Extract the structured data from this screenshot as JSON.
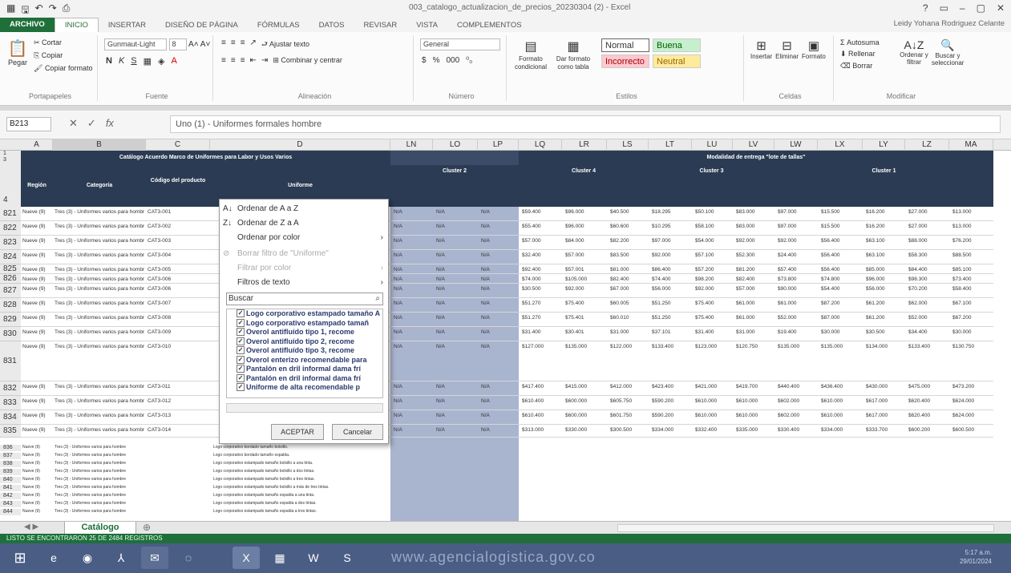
{
  "titlebar": {
    "document_title": "003_catalogo_actualizacion_de_precios_20230304 (2) - Excel",
    "window_controls": [
      "?",
      "▭",
      "–",
      "▢",
      "✕"
    ]
  },
  "tabs": [
    "ARCHIVO",
    "INICIO",
    "INSERTAR",
    "DISEÑO DE PÁGINA",
    "FÓRMULAS",
    "DATOS",
    "REVISAR",
    "VISTA",
    "COMPLEMENTOS"
  ],
  "user": "Leidy Yohana Rodriguez Celante",
  "ribbon": {
    "clipboard": {
      "paste": "Pegar",
      "cut": "Cortar",
      "copy": "Copiar",
      "format_painter": "Copiar formato",
      "label": "Portapapeles"
    },
    "font": {
      "name": "Gunmaut-Light",
      "size": "8",
      "bold": "N",
      "italic": "K",
      "underline": "S",
      "label": "Fuente"
    },
    "alignment": {
      "wrap": "Ajustar texto",
      "merge": "Combinar y centrar",
      "label": "Alineación"
    },
    "number": {
      "format": "General",
      "currency": "$",
      "percent": "%",
      "thousands": "000",
      "label": "Número"
    },
    "styles": {
      "conditional": "Formato condicional",
      "as_table": "Dar formato como tabla",
      "normal": "Normal",
      "good": "Buena",
      "bad": "Incorrecto",
      "neutral": "Neutral",
      "label": "Estilos"
    },
    "cells": {
      "insert": "Insertar",
      "delete": "Eliminar",
      "format": "Formato",
      "label": "Celdas"
    },
    "editing": {
      "autosum": "Autosuma",
      "fill": "Rellenar",
      "clear": "Borrar",
      "sort": "Ordenar y filtrar",
      "find": "Buscar y seleccionar",
      "label": "Modificar"
    }
  },
  "formula_bar": {
    "name_box": "B213",
    "formula": "Uno (1) - Uniformes formales hombre"
  },
  "columns": [
    "A",
    "B",
    "C",
    "D",
    "LN",
    "LO",
    "LP",
    "LQ",
    "LR",
    "LS",
    "LT",
    "LU",
    "LV",
    "LW",
    "LX",
    "LY",
    "LZ",
    "MA"
  ],
  "table_title": "Catálogo Acuerdo Marco de Uniformes para Labor y Usos Varios",
  "modality_title": "Modalidad de entrega \"lote de tallas\"",
  "headers": {
    "region": "Región",
    "category": "Categoría",
    "code": "Código del producto",
    "uniform": "Uniforme",
    "cluster_left": "Cluster 2",
    "cluster_mid": "Cluster 4",
    "cluster_right": "Cluster 3",
    "cluster_far": "Cluster 1"
  },
  "rows": [
    {
      "num": "821",
      "region": "Nueve (9)",
      "category": "Tres (3) - Uniformes varios para hombre",
      "code": "CAT3-001"
    },
    {
      "num": "822",
      "region": "Nueve (9)",
      "category": "Tres (3) - Uniformes varios para hombre",
      "code": "CAT3-002"
    },
    {
      "num": "823",
      "region": "Nueve (9)",
      "category": "Tres (3) - Uniformes varios para hombre",
      "code": "CAT3-003"
    },
    {
      "num": "824",
      "region": "Nueve (9)",
      "category": "Tres (3) - Uniformes varios para hombre",
      "code": "CAT3-004"
    },
    {
      "num": "825",
      "region": "Nueve (9)",
      "category": "Tres (3) - Uniformes varios para hombre",
      "code": "CAT3-005"
    },
    {
      "num": "826",
      "region": "Nueve (9)",
      "category": "Tres (3) - Uniformes varios para hombre",
      "code": "CAT3-006"
    },
    {
      "num": "827",
      "region": "Nueve (9)",
      "category": "Tres (3) - Uniformes varios para hombre",
      "code": "CAT3-006"
    },
    {
      "num": "828",
      "region": "Nueve (9)",
      "category": "Tres (3) - Uniformes varios para hombre",
      "code": "CAT3-007"
    },
    {
      "num": "829",
      "region": "Nueve (9)",
      "category": "Tres (3) - Uniformes varios para hombre",
      "code": "CAT3-008"
    },
    {
      "num": "830",
      "region": "Nueve (9)",
      "category": "Tres (3) - Uniformes varios para hombre",
      "code": "CAT3-009"
    },
    {
      "num": "831",
      "region": "Nueve (9)",
      "category": "Tres (3) - Uniformes varios para hombre",
      "code": "CAT3-010"
    },
    {
      "num": "832",
      "region": "Nueve (9)",
      "category": "Tres (3) - Uniformes varios para hombre",
      "code": "CAT3-011"
    },
    {
      "num": "833",
      "region": "Nueve (9)",
      "category": "Tres (3) - Uniformes varios para hombre",
      "code": "CAT3-012"
    },
    {
      "num": "834",
      "region": "Nueve (9)",
      "category": "Tres (3) - Uniformes varios para hombre",
      "code": "CAT3-013"
    },
    {
      "num": "835",
      "region": "Nueve (9)",
      "category": "Tres (3) - Uniformes varios para hombre",
      "code": "CAT3-014"
    }
  ],
  "row_values": [
    [
      "N/A",
      "N/A",
      "N/A",
      "$59.400",
      "$96.000",
      "$40.500",
      "$18.295",
      "$50.100",
      "$83.000",
      "$97.000",
      "$15.500",
      "$16.200",
      "$27.000",
      "$13.000"
    ],
    [
      "N/A",
      "N/A",
      "N/A",
      "$55.400",
      "$96.000",
      "$60.600",
      "$10.295",
      "$58.100",
      "$83.000",
      "$97.000",
      "$15.500",
      "$16.200",
      "$27.000",
      "$13.000"
    ],
    [
      "N/A",
      "N/A",
      "N/A",
      "$57.000",
      "$84.000",
      "$82.200",
      "$97.000",
      "$54.000",
      "$92.000",
      "$92.000",
      "$56.400",
      "$63.100",
      "$88.000",
      "$76.200"
    ],
    [
      "N/A",
      "N/A",
      "N/A",
      "$32.400",
      "$57.000",
      "$83.500",
      "$92.000",
      "$57.100",
      "$52.300",
      "$24.400",
      "$56.400",
      "$63.100",
      "$58.300",
      "$88.500"
    ],
    [
      "N/A",
      "N/A",
      "N/A",
      "$92.400",
      "$57.001",
      "$81.000",
      "$86.400",
      "$57.200",
      "$81.200",
      "$57.400",
      "$56.400",
      "$85.000",
      "$84.400",
      "$85.100"
    ],
    [
      "N/A",
      "N/A",
      "N/A",
      "$74.000",
      "$105.000",
      "$82.400",
      "$74.400",
      "$98.200",
      "$82.400",
      "$73.800",
      "$74.800",
      "$96.000",
      "$98.300",
      "$73.400"
    ],
    [
      "N/A",
      "N/A",
      "N/A",
      "$30.500",
      "$92.000",
      "$67.000",
      "$56.000",
      "$92.000",
      "$57.000",
      "$90.000",
      "$54.400",
      "$56.000",
      "$70.200",
      "$58.400"
    ],
    [
      "N/A",
      "N/A",
      "N/A",
      "$51.270",
      "$75.400",
      "$60.005",
      "$51.250",
      "$75.400",
      "$61.000",
      "$61.000",
      "$87.200",
      "$61.200",
      "$62.000",
      "$67.100"
    ],
    [
      "N/A",
      "N/A",
      "N/A",
      "$51.270",
      "$75.401",
      "$60.010",
      "$51.250",
      "$75.400",
      "$61.000",
      "$52.000",
      "$87.000",
      "$61.200",
      "$52.000",
      "$67.200"
    ],
    [
      "N/A",
      "N/A",
      "N/A",
      "$31.400",
      "$30.401",
      "$31.000",
      "$37.101",
      "$31.400",
      "$31.000",
      "$19.400",
      "$30.000",
      "$30.500",
      "$34.400",
      "$30.000"
    ],
    [
      "N/A",
      "N/A",
      "N/A",
      "$127.000",
      "$135.000",
      "$122.000",
      "$133.400",
      "$123.000",
      "$120.750",
      "$135.000",
      "$135.000",
      "$134.000",
      "$133.400",
      "$130.750"
    ],
    [
      "N/A",
      "N/A",
      "N/A",
      "$417.400",
      "$415.000",
      "$412.000",
      "$423.400",
      "$421.000",
      "$419.700",
      "$440.400",
      "$436.400",
      "$430.000",
      "$475.000",
      "$473.200"
    ],
    [
      "N/A",
      "N/A",
      "N/A",
      "$610.400",
      "$600.000",
      "$605.750",
      "$590.200",
      "$610.000",
      "$610.000",
      "$602.000",
      "$610.000",
      "$617.000",
      "$620.400",
      "$624.000"
    ],
    [
      "N/A",
      "N/A",
      "N/A",
      "$610.400",
      "$600.000",
      "$601.750",
      "$590.200",
      "$610.000",
      "$610.000",
      "$602.000",
      "$610.000",
      "$617.000",
      "$620.400",
      "$624.000"
    ],
    [
      "N/A",
      "N/A",
      "N/A",
      "$313.000",
      "$330.000",
      "$300.500",
      "$334.000",
      "$332.400",
      "$335.000",
      "$330.400",
      "$334.000",
      "$333.700",
      "$600.200",
      "$600.500"
    ]
  ],
  "dropdown": {
    "sort_az": "Ordenar de A a Z",
    "sort_za": "Ordenar de Z a A",
    "sort_color": "Ordenar por color",
    "clear_filter": "Borrar filtro de \"Uniforme\"",
    "filter_color": "Filtrar por color",
    "text_filters": "Filtros de texto",
    "search_placeholder": "Buscar",
    "items": [
      "Logo corporativo estampado tamaño A",
      "Logo corporativo estampado tamañ",
      "Overol antifluído tipo 1, recome",
      "Overol antifluído tipo 2, recome",
      "Overol antifluído tipo 3, recome",
      "Overol enterizo recomendable para",
      "Pantalón en dril informal dama frí",
      "Pantalón en dril informal dama frí",
      "Uniforme de alta recomendable p"
    ],
    "ok": "ACEPTAR",
    "cancel": "Cancelar"
  },
  "lower_rows": {
    "nums": [
      "836",
      "837",
      "838",
      "839",
      "840",
      "841",
      "842",
      "843",
      "844"
    ],
    "uniforms": [
      "Logo corporativo bordado tamaño bolsillo.",
      "Logo corporativo bordado tamaño espalda.",
      "Logo corporativo estampado tamaño bolsillo a una tinta.",
      "Logo corporativo estampado tamaño bolsillo a dos tintas.",
      "Logo corporativo estampado tamaño bolsillo a tres tintas.",
      "Logo corporativo estampado tamaño bolsillo a más de tres tintas.",
      "Logo corporativo estampado tamaño espalda a una tinta.",
      "Logo corporativo estampado tamaño espalda a dos tintas.",
      "Logo corporativo estampado tamaño espalda a tres tintas."
    ]
  },
  "sheet_tab": "Catálogo",
  "status": "LISTO   SE ENCONTRARON 25 DE 2484 REGISTROS",
  "watermark": "www.agencialogistica.gov.co",
  "clock": {
    "time": "5:17 a.m.",
    "date": "29/01/2024"
  }
}
